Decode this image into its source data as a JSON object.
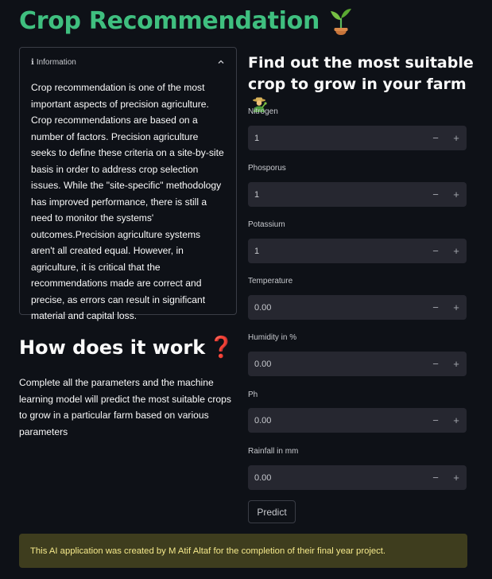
{
  "app": {
    "title": "Crop Recommendation"
  },
  "info_expander": {
    "header_icon": "info-icon",
    "header_label": "Information",
    "body": "Crop recommendation is one of the most important aspects of precision agriculture. Crop recommendations are based on a number of factors. Precision agriculture seeks to define these criteria on a site-by-site basis in order to address crop selection issues. While the \"site-specific\" methodology has improved performance, there is still a need to monitor the systems' outcomes.Precision agriculture systems aren't all created equal. However, in agriculture, it is critical that the recommendations made are correct and precise, as errors can result in significant material and capital loss."
  },
  "how_it_works": {
    "heading": "How does it work",
    "text": "Complete all the parameters and the machine learning model will predict the most suitable crops to grow in a particular farm based on various parameters"
  },
  "form": {
    "heading": "Find out the most suitable crop to grow in your farm",
    "fields": [
      {
        "label": "Nitrogen",
        "value": "1"
      },
      {
        "label": "Phosporus",
        "value": "1"
      },
      {
        "label": "Potassium",
        "value": "1"
      },
      {
        "label": "Temperature",
        "value": "0.00"
      },
      {
        "label": "Humidity in %",
        "value": "0.00"
      },
      {
        "label": "Ph",
        "value": "0.00"
      },
      {
        "label": "Rainfall in mm",
        "value": "0.00"
      }
    ],
    "minus_label": "−",
    "plus_label": "+",
    "predict_label": "Predict"
  },
  "footer": {
    "text": "This AI application was created by M Atif Altaf for the completion of their final year project."
  },
  "colors": {
    "title_green": "#3fbf7f",
    "banner_bg": "#3e3d1e",
    "banner_text": "#f5e98a",
    "input_bg": "#262730",
    "page_bg": "#0e1117"
  }
}
